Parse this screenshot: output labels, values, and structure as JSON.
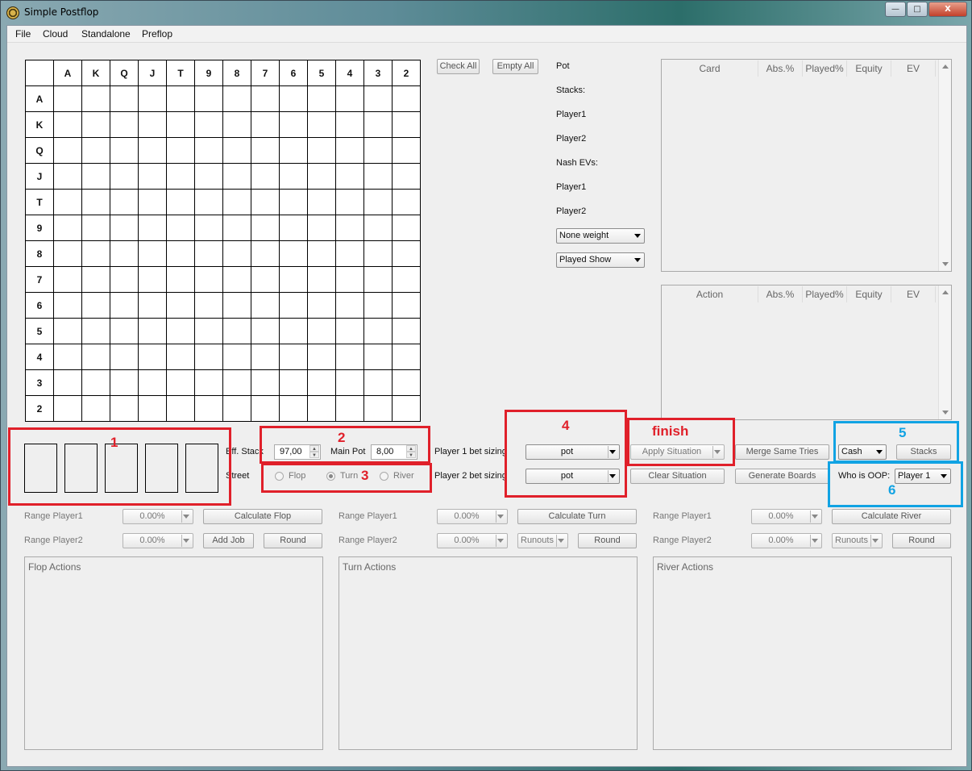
{
  "window": {
    "title": "Simple Postflop",
    "minimize": "—",
    "maximize": "□",
    "close": "X"
  },
  "menu": [
    "File",
    "Cloud",
    "Standalone",
    "Preflop"
  ],
  "grid": {
    "ranks": [
      "A",
      "K",
      "Q",
      "J",
      "T",
      "9",
      "8",
      "7",
      "6",
      "5",
      "4",
      "3",
      "2"
    ]
  },
  "buttons": {
    "check_all": "Check All",
    "empty_all": "Empty All"
  },
  "info": {
    "pot": "Pot",
    "stacks": "Stacks:",
    "p1": "Player1",
    "p2": "Player2",
    "nash": "Nash EVs:",
    "p1b": "Player1",
    "p2b": "Player2"
  },
  "weight_combo": "None weight",
  "show_combo": "Played Show",
  "card_table": {
    "headers": [
      "Card",
      "Abs.%",
      "Played%",
      "Equity",
      "EV"
    ]
  },
  "action_table": {
    "headers": [
      "Action",
      "Abs.%",
      "Played%",
      "Equity",
      "EV"
    ]
  },
  "situation": {
    "eff_stack_label": "Eff. Stack",
    "eff_stack_value": "97,00",
    "main_pot_label": "Main Pot",
    "main_pot_value": "8,00",
    "street_label": "Street",
    "streets": [
      "Flop",
      "Turn",
      "River"
    ],
    "selected_street": "Turn",
    "p1_sizing_label": "Player 1 bet sizing",
    "p1_sizing": "pot",
    "p2_sizing_label": "Player 2 bet sizing",
    "p2_sizing": "pot",
    "apply": "Apply Situation",
    "merge": "Merge Same Tries",
    "clear": "Clear Situation",
    "generate": "Generate Boards",
    "game_type": "Cash",
    "stacks_btn": "Stacks",
    "oop_label": "Who is OOP:",
    "oop_value": "Player 1"
  },
  "calc": {
    "flop": {
      "rp1": "Range Player1",
      "rp2": "Range Player2",
      "v1": "0.00%",
      "v2": "0.00%",
      "calc": "Calculate Flop",
      "add": "Add Job",
      "round": "Round"
    },
    "turn": {
      "rp1": "Range Player1",
      "rp2": "Range Player2",
      "v1": "0.00%",
      "v2": "0.00%",
      "calc": "Calculate Turn",
      "runouts": "Runouts",
      "round": "Round"
    },
    "river": {
      "rp1": "Range Player1",
      "rp2": "Range Player2",
      "v1": "0.00%",
      "v2": "0.00%",
      "calc": "Calculate River",
      "runouts": "Runouts",
      "round": "Round"
    }
  },
  "panels": {
    "flop": "Flop Actions",
    "turn": "Turn Actions",
    "river": "River Actions"
  },
  "annotations": {
    "n1": "1",
    "n2": "2",
    "n3": "3",
    "n4": "4",
    "finish": "finish",
    "n5": "5",
    "n6": "6"
  },
  "colors": {
    "annotation_red": "#e0202a",
    "annotation_blue": "#11a3e3"
  }
}
